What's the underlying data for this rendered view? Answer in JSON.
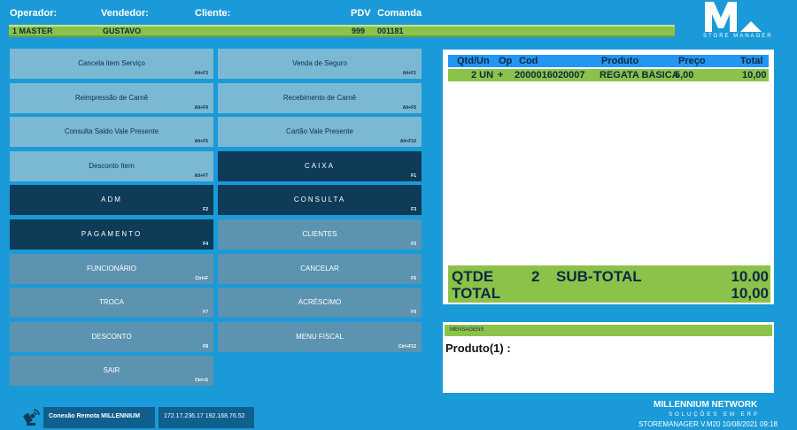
{
  "header": {
    "operador_label": "Operador:",
    "vendedor_label": "Vendedor:",
    "cliente_label": "Cliente:",
    "pdv_label": "PDV",
    "comanda_label": "Comanda",
    "operador_value": "1 MASTER",
    "vendedor_value": "GUSTAVO",
    "pdv_value": "999",
    "comanda_value": "001181"
  },
  "logo": {
    "letter": "M",
    "subtitle": "STORE MANAGER"
  },
  "buttons": [
    {
      "label": "Cancela item Serviço",
      "key": "Alt+F3",
      "style": "light"
    },
    {
      "label": "Venda de Seguro",
      "key": "Alt+F1",
      "style": "light"
    },
    {
      "label": "Reimpressão de Carnê",
      "key": "Alt+F9",
      "style": "light"
    },
    {
      "label": "Recebimento de Carnê",
      "key": "Alt+F5",
      "style": "light"
    },
    {
      "label": "Consulta Saldo Vale Presente",
      "key": "Alt+F6",
      "style": "light"
    },
    {
      "label": "Cartão Vale Presente",
      "key": "Alt+F10",
      "style": "light"
    },
    {
      "label": "Desconto Item",
      "key": "Alt+F7",
      "style": "light"
    },
    {
      "label": "CAIXA",
      "key": "F1",
      "style": "dark"
    },
    {
      "label": "ADM",
      "key": "F2",
      "style": "dark"
    },
    {
      "label": "CONSULTA",
      "key": "F3",
      "style": "dark"
    },
    {
      "label": "PAGAMENTO",
      "key": "F4",
      "style": "dark"
    },
    {
      "label": "CLIENTES",
      "key": "F5",
      "style": "mid"
    },
    {
      "label": "FUNCIONÁRIO",
      "key": "Ctrl+F",
      "style": "mid"
    },
    {
      "label": "CANCELAR",
      "key": "F6",
      "style": "mid"
    },
    {
      "label": "TROCA",
      "key": "F7",
      "style": "mid"
    },
    {
      "label": "ACRÉSCIMO",
      "key": "F9",
      "style": "mid"
    },
    {
      "label": "DESCONTO",
      "key": "F8",
      "style": "mid"
    },
    {
      "label": "MENU FISCAL",
      "key": "Ctrl+F12",
      "style": "mid"
    },
    {
      "label": "SAIR",
      "key": "Ctrl+S",
      "style": "mid"
    }
  ],
  "grid": {
    "columns": [
      "Qtd/Un",
      "Op",
      "Cod",
      "Produto",
      "Preço",
      "Total"
    ],
    "rows": [
      [
        "2 UN",
        "+",
        "2000016020007",
        "REGATA BÁSICA I",
        "5,00",
        "10,00"
      ]
    ]
  },
  "totals": {
    "qtde_label": "QTDE",
    "qtde_value": "2",
    "subtotal_label": "SUB-TOTAL",
    "subtotal_value": "10.00",
    "total_label": "TOTAL",
    "total_value": "10,00"
  },
  "messages": {
    "header": "MENSAGENS",
    "text": "Produto(1) :"
  },
  "footer": {
    "connection_label": "Conexão Remota MILLENNIUM",
    "ip_addresses": "172.17.236.17 192.168.76.52",
    "brand": "MILLENNIUM NETWORK",
    "brand_sub": "SOLUÇÕES EM ERP",
    "version": "STOREMANAGER V.M20   10/08/2021 09:18"
  },
  "colors": {
    "background": "#1a9ad8",
    "accent_green": "#8bc34a",
    "dark_button": "#0d3b58",
    "grid_header": "#2196f3"
  }
}
